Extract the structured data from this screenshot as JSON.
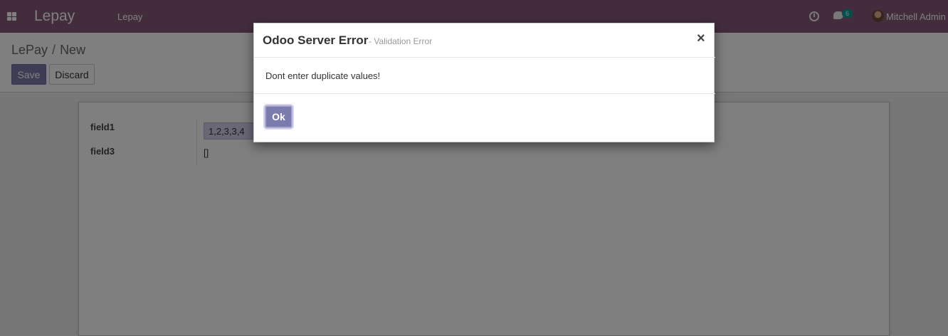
{
  "navbar": {
    "app_name": "Lepay",
    "menu_item": "Lepay",
    "activity_icon": "clock-icon",
    "messaging_icon": "chat-icon",
    "message_count": "6",
    "user_name": "Mitchell Admin"
  },
  "control_panel": {
    "breadcrumb_parent": "LePay",
    "breadcrumb_separator": "/",
    "breadcrumb_current": "New",
    "save_label": "Save",
    "discard_label": "Discard"
  },
  "form": {
    "field1_label": "field1",
    "field1_value": "1,2,3,3,4",
    "field3_label": "field3",
    "field3_value": "[]"
  },
  "dialog": {
    "title": "Odoo Server Error",
    "subtitle": "- Validation Error",
    "close_glyph": "×",
    "message": "Dont enter duplicate values!",
    "ok_label": "Ok"
  },
  "colors": {
    "navbar": "#875a7b",
    "primary_button": "#7c7bad",
    "badge": "#00a09d"
  }
}
